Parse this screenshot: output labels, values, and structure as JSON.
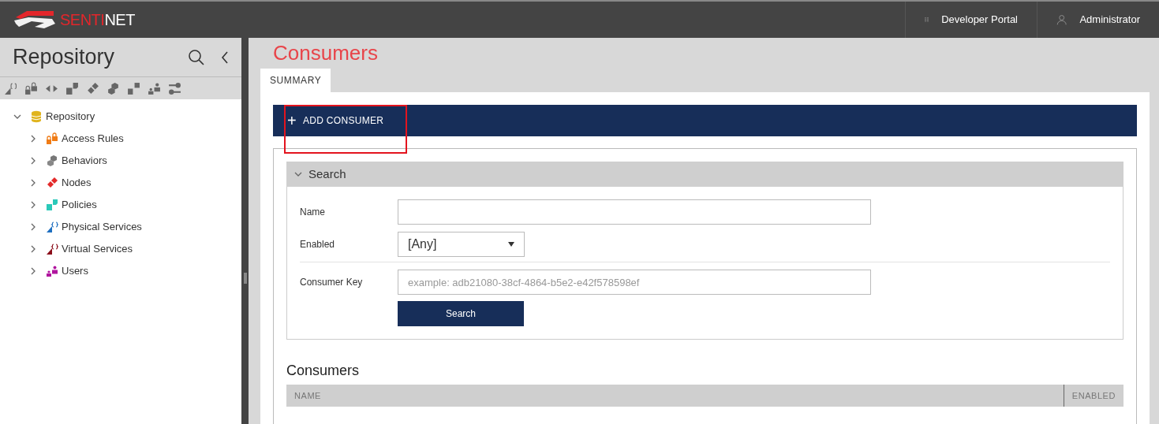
{
  "logo": {
    "parts": [
      {
        "text": "SENTI",
        "color": "#e3262b"
      },
      {
        "text": "NET",
        "color": "#ffffff"
      }
    ]
  },
  "header_links": [
    {
      "kind": "grid",
      "label": "Developer Portal"
    },
    {
      "kind": "user",
      "label": "Administrator"
    }
  ],
  "sidebar": {
    "title": "Repository",
    "tree": [
      {
        "kind": "database",
        "label": "Repository",
        "expanded": true,
        "children": [
          {
            "kind": "lock",
            "label": "Access Rules",
            "expanded": false
          },
          {
            "kind": "behavior",
            "label": "Behaviors",
            "expanded": false
          },
          {
            "kind": "node",
            "label": "Nodes",
            "expanded": false
          },
          {
            "kind": "policy",
            "label": "Policies",
            "expanded": false
          },
          {
            "kind": "physical",
            "label": "Physical Services",
            "expanded": false
          },
          {
            "kind": "virtual",
            "label": "Virtual Services",
            "expanded": false
          },
          {
            "kind": "users",
            "label": "Users",
            "expanded": false
          }
        ]
      }
    ]
  },
  "page_title": "Consumers",
  "tabs": [
    {
      "label": "SUMMARY",
      "selected": true
    }
  ],
  "add_button": {
    "icon": "+",
    "label": "ADD CONSUMER",
    "highlighted": true
  },
  "search": {
    "title": "Search",
    "expanded": true,
    "fields": [
      {
        "kind": "text",
        "label": "Name"
      },
      {
        "kind": "select",
        "label": "Enabled",
        "value": "[Any]"
      },
      {
        "kind": "text",
        "label": "Consumer Key",
        "placeholder": "example: adb21080-38cf-4864-b5e2-e42f578598ef"
      }
    ],
    "button": "Search"
  },
  "results": {
    "title": "Consumers",
    "columns": [
      "NAME",
      "ENABLED"
    ]
  }
}
